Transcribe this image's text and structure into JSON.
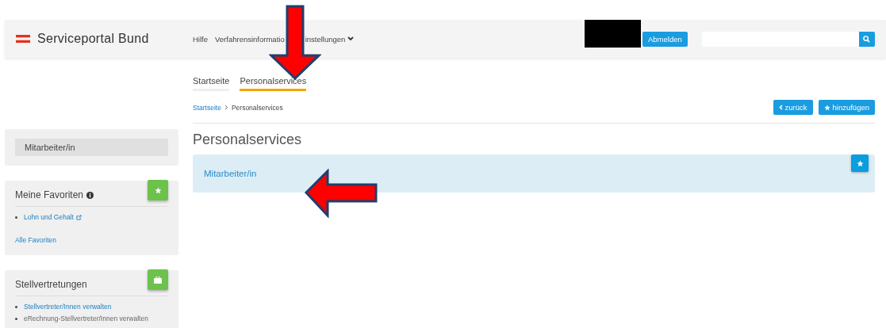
{
  "header": {
    "logo": "Serviceportal Bund",
    "nav": [
      {
        "label": "Hilfe",
        "dropdown": false
      },
      {
        "label": "Verfahrensinformatio",
        "dropdown": false
      },
      {
        "label": "instellungen",
        "dropdown": true
      }
    ],
    "logout_button": "Abmelden"
  },
  "sidebar": {
    "selected_item": "Mitarbeiter/in",
    "favorites": {
      "title": "Meine Favoriten",
      "items": [
        {
          "label": "Lohn und Gehalt",
          "external": true
        }
      ],
      "link": "Alle Favoriten"
    },
    "deputies": {
      "title": "Stellvertretungen",
      "items": [
        {
          "label": "Stellvertreter/Innen verwalten",
          "link": true
        },
        {
          "label": "eRechnung-Stellvertreter/Innen verwalten",
          "link": false
        }
      ]
    }
  },
  "tabs": [
    {
      "label": "Startseite",
      "selected": false
    },
    {
      "label": "Personalservices",
      "selected": true
    }
  ],
  "breadcrumb": [
    "Startseite",
    "Personalservices"
  ],
  "actions": [
    {
      "kind": "back",
      "label": "zurück"
    },
    {
      "kind": "favorite",
      "label": "hinzufügen"
    }
  ],
  "heading": "Personalservices",
  "cards": [
    {
      "label": "Mitarbeiter/in"
    }
  ],
  "annotations": [
    {
      "kind": "down"
    },
    {
      "kind": "left"
    }
  ]
}
